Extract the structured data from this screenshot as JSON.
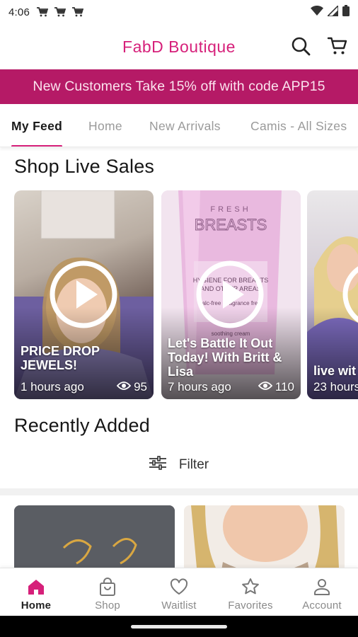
{
  "status_bar": {
    "time": "4:06",
    "notification_icons": [
      "cart-icon",
      "cart-icon",
      "cart-icon"
    ],
    "right_icons": [
      "wifi-icon",
      "signal-icon",
      "battery-icon"
    ]
  },
  "app_bar": {
    "title": "FabD Boutique",
    "brand_color": "#d6207a",
    "icons": [
      "search-icon",
      "cart-icon"
    ]
  },
  "promo": {
    "text": "New Customers Take 15% off with code APP15",
    "bg_color": "#b51a66"
  },
  "tabs": [
    {
      "label": "My Feed",
      "active": true
    },
    {
      "label": "Home",
      "active": false
    },
    {
      "label": "New Arrivals",
      "active": false
    },
    {
      "label": "Camis - All Sizes",
      "active": false
    }
  ],
  "live_sales": {
    "title": "Shop Live Sales",
    "cards": [
      {
        "title": "PRICE DROP JEWELS!",
        "ago": "1 hours ago",
        "views": "95"
      },
      {
        "title": "Let's Battle It Out Today! With Britt & Lisa",
        "ago": "7 hours ago",
        "views": "110"
      },
      {
        "title": "live wit",
        "ago": "23 hours",
        "views": ""
      }
    ]
  },
  "recently_added": {
    "title": "Recently Added",
    "filter_label": "Filter"
  },
  "bottom_nav": [
    {
      "label": "Home",
      "icon": "home-icon",
      "active": true
    },
    {
      "label": "Shop",
      "icon": "shopping-bag-icon",
      "active": false
    },
    {
      "label": "Waitlist",
      "icon": "heart-icon",
      "active": false
    },
    {
      "label": "Favorites",
      "icon": "star-icon",
      "active": false
    },
    {
      "label": "Account",
      "icon": "person-icon",
      "active": false
    }
  ]
}
